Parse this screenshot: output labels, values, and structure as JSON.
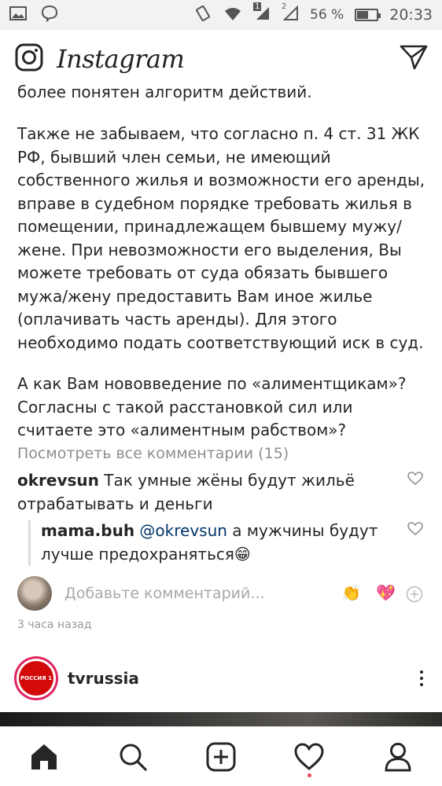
{
  "status_bar": {
    "sim_badge": "1",
    "network_badge": "2",
    "battery_percent": "56 %",
    "battery_level": 0.56,
    "time": "20:33"
  },
  "header": {
    "title": "Instagram"
  },
  "post": {
    "caption_cut_line": "более понятен алгоритм действий.",
    "caption_paragraph": "Также не забываем, что согласно п. 4 ст. 31 ЖК РФ, бывший член семьи, не имеющий собственного жилья и возможности его аренды, вправе в судебном порядке требовать жилья в помещении, принадлежащем бывшему мужу/жене. При невозможности его выделения, Вы можете требовать от суда обязать бывшего мужа/жену предоставить Вам иное жилье (оплачивать часть аренды). Для этого необходимо подать соответствующий иск в суд.",
    "caption_question": "А как Вам нововведение по «алиментщикам»? Согласны с такой расстановкой сил или считаете это «алиментным рабством»?",
    "view_all_comments": "Посмотреть все комментарии (15)",
    "comments": [
      {
        "user": "okrevsun",
        "text": "Так умные жёны будут жильё отрабатывать и деньги"
      },
      {
        "user": "mama.buh",
        "mention": "@okrevsun",
        "text": "а мужчины будут лучше предохраняться😁"
      }
    ],
    "add_comment_placeholder": "Добавьте комментарий...",
    "quick_emojis": [
      "👏",
      "💖"
    ],
    "time_ago": "3 часа назад"
  },
  "next_post": {
    "username": "tvrussia",
    "logo_text": "РОССИЯ 1"
  },
  "icons": [
    "camera-icon",
    "direct-message-icon",
    "home-icon",
    "search-icon",
    "new-post-icon",
    "activity-icon",
    "profile-icon"
  ]
}
